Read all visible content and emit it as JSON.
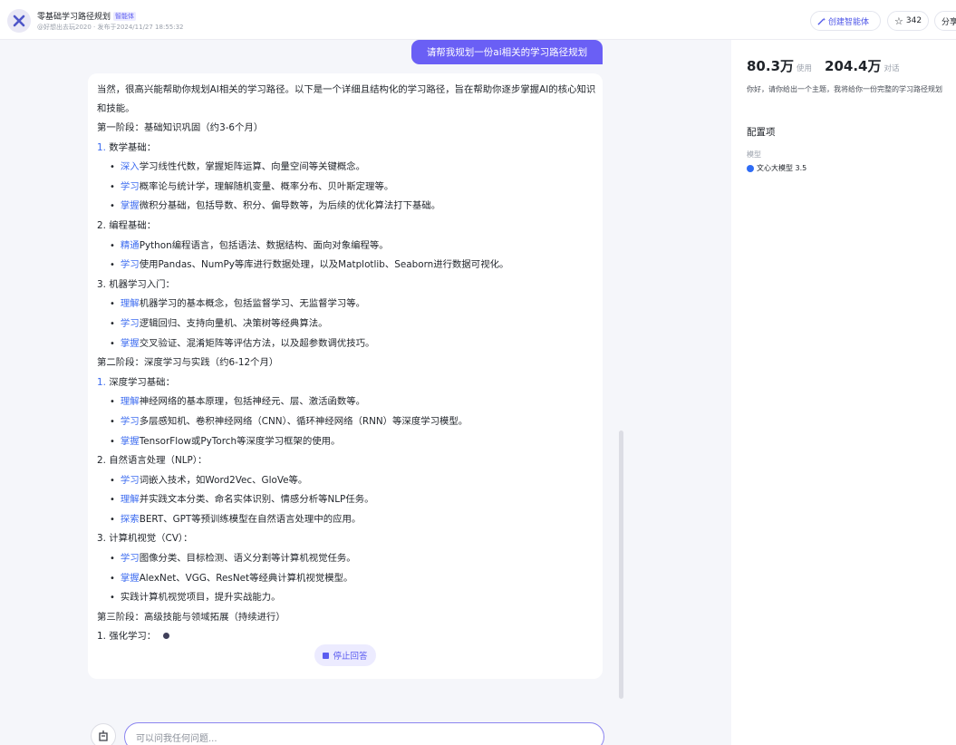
{
  "header": {
    "title": "零基础学习路径规划",
    "badge": "智能体",
    "meta": "@好想出去玩2020 · 发布于2024/11/27 18:55:32",
    "create_label": "创建智能体",
    "star_count": "342",
    "share_label": "分享"
  },
  "chat": {
    "user_message": "请帮我规划一份ai相关的学习路径规划",
    "answer": {
      "intro": "当然，很高兴能帮助你规划AI相关的学习路径。以下是一个详细且结构化的学习路径，旨在帮助你逐步掌握AI的核心知识和技能。",
      "stage1": "第一阶段：基础知识巩固（约3-6个月）",
      "s1_i1_n": "1.",
      "s1_i1": "数学基础：",
      "s1_i1_b1_hl": "深入",
      "s1_i1_b1": "学习线性代数，掌握矩阵运算、向量空间等关键概念。",
      "s1_i1_b2_hl": "学习",
      "s1_i1_b2": "概率论与统计学，理解随机变量、概率分布、贝叶斯定理等。",
      "s1_i1_b3_hl": "掌握",
      "s1_i1_b3": "微积分基础，包括导数、积分、偏导数等，为后续的优化算法打下基础。",
      "s1_i2": "2. 编程基础：",
      "s1_i2_b1_hl": "精通",
      "s1_i2_b1": "Python编程语言，包括语法、数据结构、面向对象编程等。",
      "s1_i2_b2_hl": "学习",
      "s1_i2_b2": "使用Pandas、NumPy等库进行数据处理，以及Matplotlib、Seaborn进行数据可视化。",
      "s1_i3": "3. 机器学习入门：",
      "s1_i3_b1_hl": "理解",
      "s1_i3_b1": "机器学习的基本概念，包括监督学习、无监督学习等。",
      "s1_i3_b2_hl": "学习",
      "s1_i3_b2": "逻辑回归、支持向量机、决策树等经典算法。",
      "s1_i3_b3_hl": "掌握",
      "s1_i3_b3": "交叉验证、混淆矩阵等评估方法，以及超参数调优技巧。",
      "stage2": "第二阶段：深度学习与实践（约6-12个月）",
      "s2_i1_n": "1.",
      "s2_i1": "深度学习基础：",
      "s2_i1_b1_hl": "理解",
      "s2_i1_b1": "神经网络的基本原理，包括神经元、层、激活函数等。",
      "s2_i1_b2_hl": "学习",
      "s2_i1_b2": "多层感知机、卷积神经网络（CNN）、循环神经网络（RNN）等深度学习模型。",
      "s2_i1_b3_hl": "掌握",
      "s2_i1_b3": "TensorFlow或PyTorch等深度学习框架的使用。",
      "s2_i2": "2. 自然语言处理（NLP）：",
      "s2_i2_b1_hl": "学习",
      "s2_i2_b1": "词嵌入技术，如Word2Vec、GloVe等。",
      "s2_i2_b2_hl": "理解",
      "s2_i2_b2": "并实践文本分类、命名实体识别、情感分析等NLP任务。",
      "s2_i2_b3_hl": "探索",
      "s2_i2_b3": "BERT、GPT等预训练模型在自然语言处理中的应用。",
      "s2_i3": "3. 计算机视觉（CV）：",
      "s2_i3_b1_hl": "学习",
      "s2_i3_b1": "图像分类、目标检测、语义分割等计算机视觉任务。",
      "s2_i3_b2_hl": "掌握",
      "s2_i3_b2": "AlexNet、VGG、ResNet等经典计算机视觉模型。",
      "s2_i3_b3": "实践计算机视觉项目，提升实战能力。",
      "stage3": "第三阶段：高级技能与领域拓展（持续进行）",
      "s3_i1": "1. 强化学习："
    },
    "stop_label": "停止回答",
    "input_placeholder": "可以问我任何问题..."
  },
  "sidebar": {
    "usage_count": "80.3万",
    "usage_label": "使用",
    "dialog_count": "204.4万",
    "dialog_label": "对话",
    "description": "你好，请你给出一个主题，我将给你一份完整的学习路径规划",
    "config_title": "配置项",
    "model_label": "模型",
    "model_value": "文心大模型 3.5"
  },
  "colors": {
    "accent": "#6a5ff5",
    "link": "#3d6cf0",
    "background": "#f5f6fa"
  }
}
